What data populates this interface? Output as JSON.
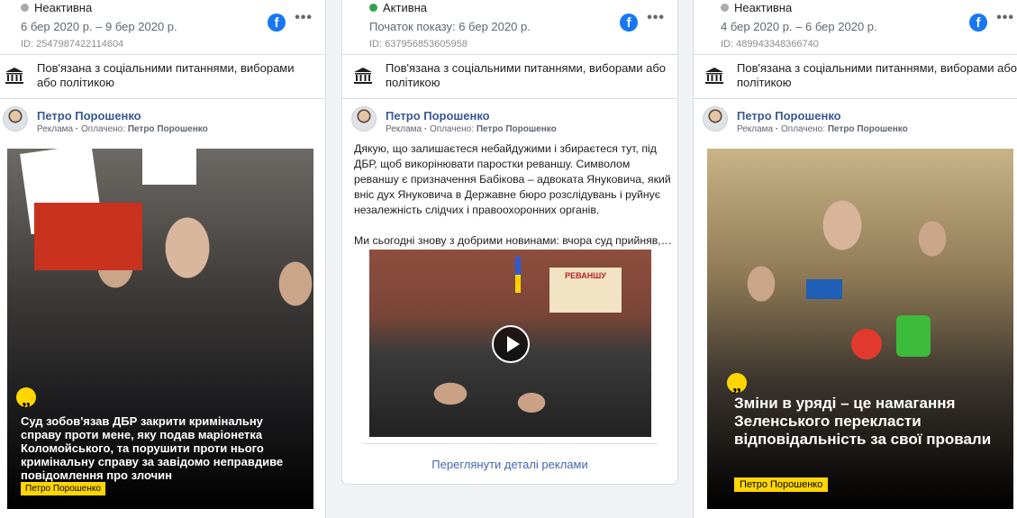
{
  "cards": [
    {
      "status": "Неактивна",
      "dates": "6 бер 2020 р. – 9 бер 2020 р.",
      "id": "ID: 2547987422114604",
      "political": "Пов'язана з соціальними питаннями, виборами або політикою",
      "page_name": "Петро Порошенко",
      "ad_label": "Реклама",
      "paid_label": "Оплачено:",
      "paid_by": "Петро Порошенко",
      "quote": "Суд зобов'язав ДБР закрити кримінальну справу проти мене, яку подав маріонетка Коломойського, та порушити проти нього кримінальну справу за завідомо неправдиве повідомлення про злочин",
      "tag": "Петро Порошенко"
    },
    {
      "status": "Активна",
      "dates": "Початок показу: 6 бер 2020 р.",
      "id": "ID: 637956853605958",
      "political": "Пов'язана з соціальними питаннями, виборами або політикою",
      "page_name": "Петро Порошенко",
      "ad_label": "Реклама",
      "paid_label": "Оплачено:",
      "paid_by": "Петро Порошенко",
      "text1": "Дякую, що залишаєтеся небайдужими і збираєтеся тут, під ДБР, щоб викорінювати паростки реваншу. Символом реваншу є призначення Бабікова – адвоката Януковича, який вніс дух Януковича в Державне бюро розслідувань і руйнує незалежність слідчих і правоохоронних органів.",
      "text2": "Ми сьогодні знову з добрими новинами: вчора суд прийняв, а...",
      "banner": "РЕВАНШУ",
      "details": "Переглянути деталі реклами"
    },
    {
      "status": "Неактивна",
      "dates": "4 бер 2020 р. – 6 бер 2020 р.",
      "id": "ID: 489943348366740",
      "political": "Пов'язана з соціальними питаннями, виборами або політикою",
      "page_name": "Петро Порошенко",
      "ad_label": "Реклама",
      "paid_label": "Оплачено:",
      "paid_by": "Петро Порошенко",
      "quote": "Зміни в уряді – це намагання Зеленського перекласти відповідальність за свої провали",
      "tag": "Петро Порошенко"
    }
  ],
  "icons": {
    "facebook": "f",
    "more": "•••",
    "quote": "„"
  },
  "colors": {
    "inactive_dot": "#a8abaf",
    "active_dot": "#31a24c",
    "link": "#385898",
    "accent_yellow": "#ffd600",
    "facebook_blue": "#1877f2"
  }
}
